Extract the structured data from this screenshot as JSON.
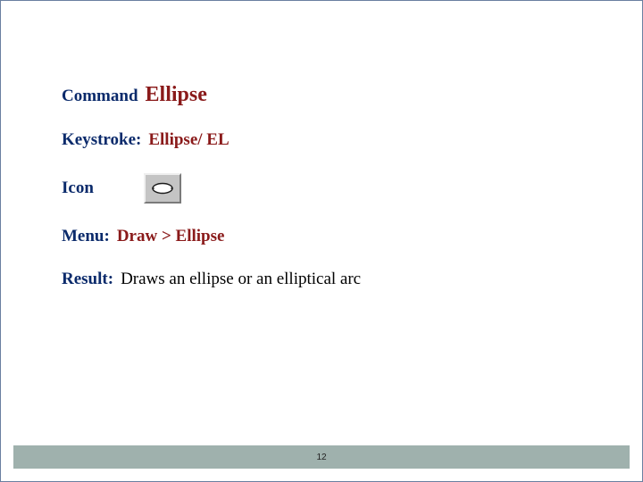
{
  "command": {
    "label": "Command",
    "value": "Ellipse"
  },
  "keystroke": {
    "label": "Keystroke:",
    "value": "Ellipse/ EL"
  },
  "icon": {
    "label": "Icon",
    "name": "ellipse-tool-icon"
  },
  "menu": {
    "label": "Menu:",
    "value": "Draw > Ellipse"
  },
  "result": {
    "label": "Result:",
    "value": "Draws an ellipse or an elliptical arc"
  },
  "page_number": "12"
}
